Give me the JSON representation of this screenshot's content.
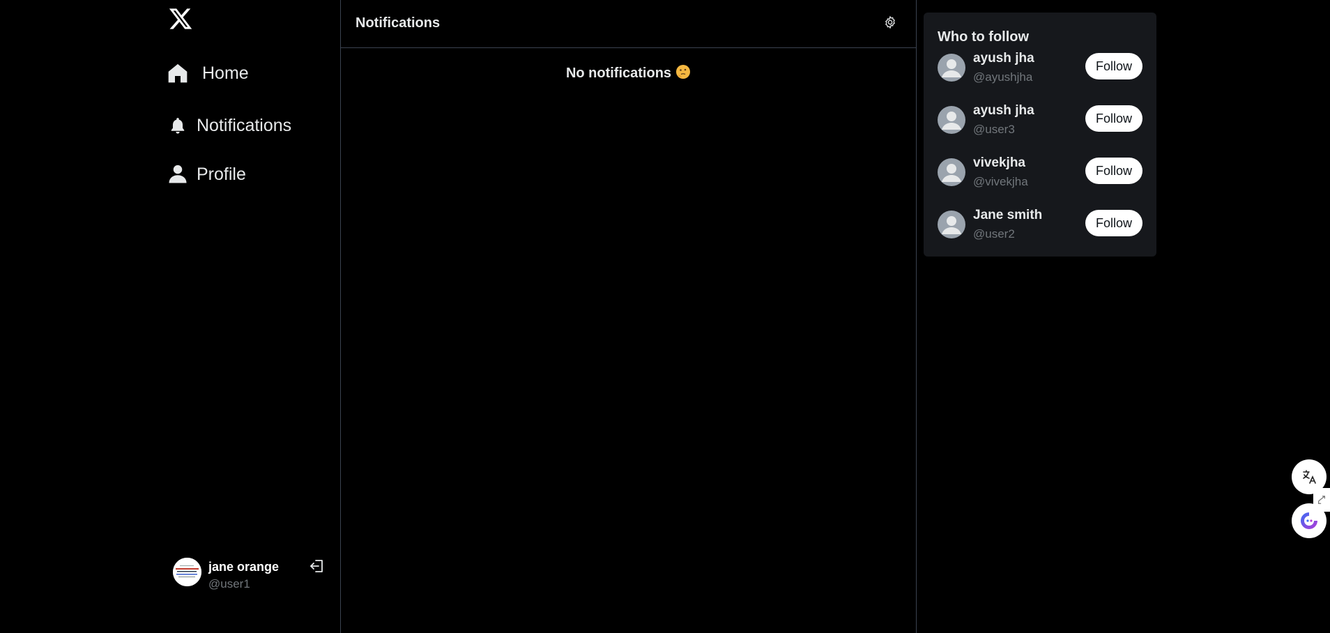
{
  "sidebar": {
    "nav": [
      {
        "label": "Home",
        "icon": "home-icon"
      },
      {
        "label": "Notifications",
        "icon": "bell-icon"
      },
      {
        "label": "Profile",
        "icon": "user-icon"
      }
    ],
    "account": {
      "name": "jane orange",
      "handle": "@user1"
    }
  },
  "main": {
    "title": "Notifications",
    "empty_text": "No notifications",
    "empty_emoji": "thinking-face"
  },
  "who_to_follow": {
    "title": "Who to follow",
    "users": [
      {
        "name": "ayush jha",
        "handle": "@ayushjha",
        "button": "Follow"
      },
      {
        "name": "ayush jha",
        "handle": "@user3",
        "button": "Follow"
      },
      {
        "name": "vivekjha",
        "handle": "@vivekjha",
        "button": "Follow"
      },
      {
        "name": "Jane smith",
        "handle": "@user2",
        "button": "Follow"
      }
    ]
  },
  "colors": {
    "background": "#000000",
    "card": "#16181c",
    "divider": "#3b4350",
    "muted": "#71767b",
    "text": "#e7e9ea"
  }
}
